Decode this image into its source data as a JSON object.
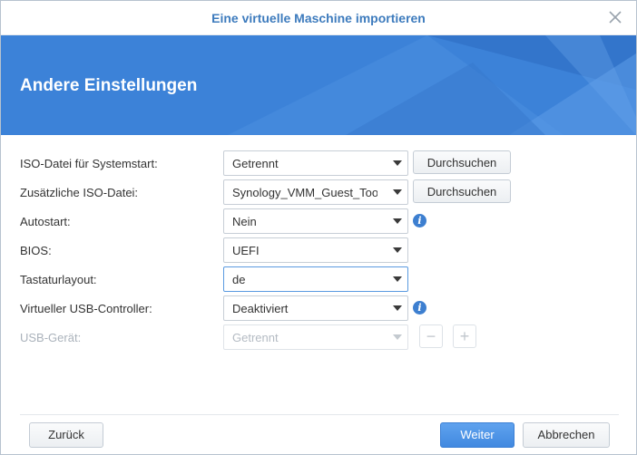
{
  "window": {
    "title": "Eine virtuelle Maschine importieren",
    "close_icon": "close-icon"
  },
  "banner": {
    "title": "Andere Einstellungen",
    "color": "#3c82d8"
  },
  "form": {
    "iso_boot": {
      "label": "ISO-Datei für Systemstart:",
      "value": "Getrennt",
      "button": "Durchsuchen"
    },
    "iso_extra": {
      "label": "Zusätzliche ISO-Datei:",
      "value": "Synology_VMM_Guest_Tool",
      "button": "Durchsuchen"
    },
    "autostart": {
      "label": "Autostart:",
      "value": "Nein",
      "info_icon": "info-icon"
    },
    "bios": {
      "label": "BIOS:",
      "value": "UEFI"
    },
    "keyboard": {
      "label": "Tastaturlayout:",
      "value": "de"
    },
    "usb_controller": {
      "label": "Virtueller USB-Controller:",
      "value": "Deaktiviert",
      "info_icon": "info-icon"
    },
    "usb_device": {
      "label": "USB-Gerät:",
      "value": "Getrennt",
      "minus": "−",
      "plus": "+"
    }
  },
  "footer": {
    "back": "Zurück",
    "next": "Weiter",
    "cancel": "Abbrechen"
  },
  "colors": {
    "accent": "#4189e0",
    "title_text": "#3d7bbd"
  }
}
